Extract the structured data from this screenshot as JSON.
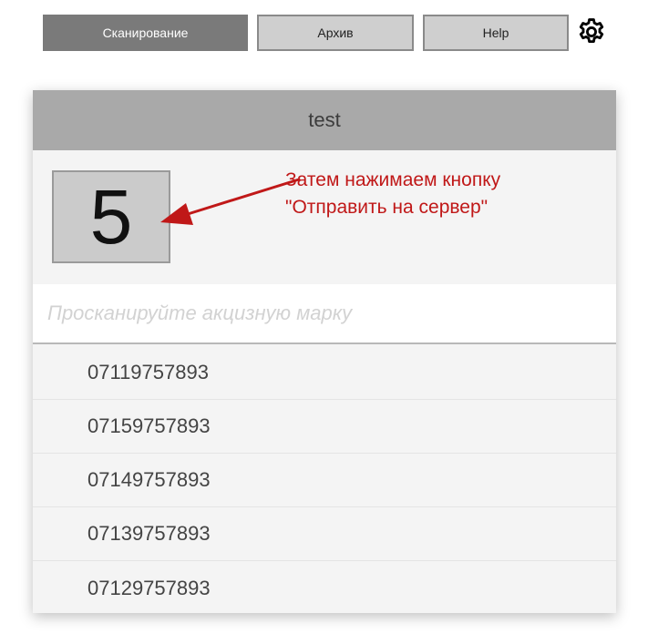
{
  "nav": {
    "scan_label": "Сканирование",
    "archive_label": "Архив",
    "help_label": "Help",
    "settings_icon": "gear-icon"
  },
  "card": {
    "title": "test",
    "counter": "5",
    "annotation": {
      "line1": "Затем нажимаем кнопку",
      "line2": "\"Отправить на сервер\""
    },
    "input": {
      "placeholder": "Просканируйте акцизную марку",
      "value": ""
    },
    "items": [
      "07119757893",
      "07159757893",
      "07149757893",
      "07139757893",
      "07129757893"
    ]
  },
  "colors": {
    "active_tab": "#7a7a7a",
    "inactive_tab": "#cfcfcf",
    "header": "#a9a9a9",
    "annotation": "#c01818"
  }
}
